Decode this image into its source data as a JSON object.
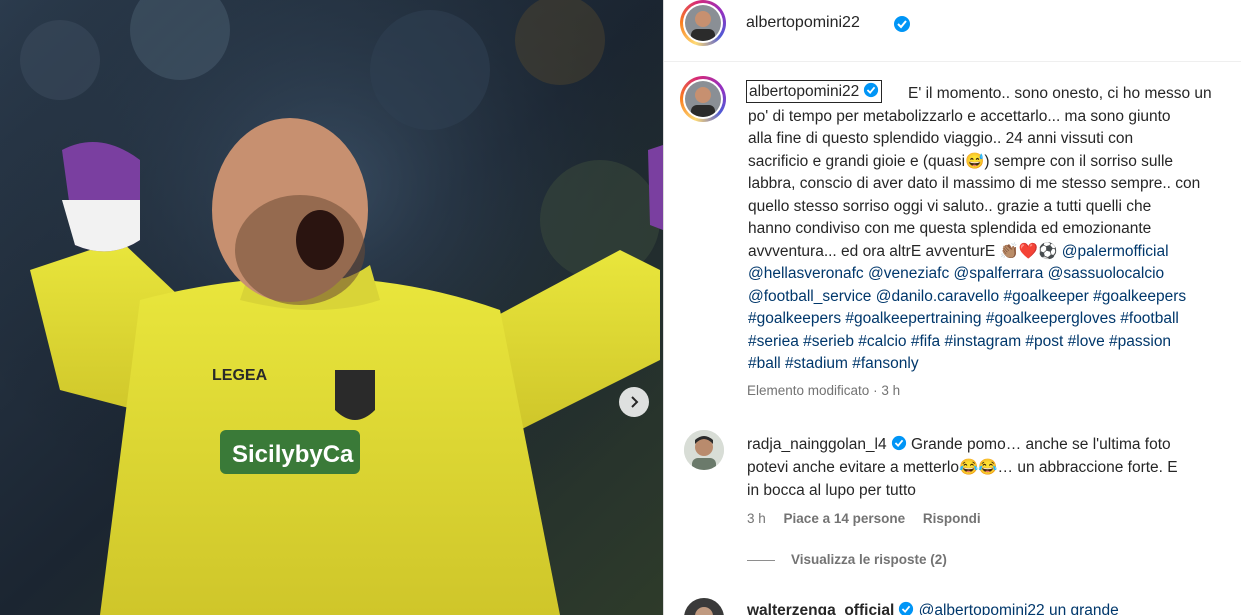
{
  "post": {
    "author": "albertopomini22",
    "verified": true
  },
  "caption": {
    "lines": [
      "E' il momento.. sono onesto, ci ho messo un",
      "po' di tempo per metabolizzarlo e accettarlo... ma sono giunto",
      "alla fine di questo splendido viaggio.. 24 anni vissuti con",
      "sacrificio e grandi gioie e (quasi😅) sempre con il sorriso sulle",
      "labbra, conscio di aver dato il massimo di me stesso sempre.. con",
      "quello stesso sorriso oggi vi saluto.. grazie a tutti quelli che",
      "hanno condiviso con me questa splendida ed emozionante",
      "avvventura... ed ora altrE avventurE 👏🏽❤️⚽"
    ],
    "mentions": [
      "@palermofficial",
      "@hellasveronafc",
      "@veneziafc",
      "@spalferrara",
      "@sassuolocalcio",
      "@football_service",
      "@danilo.caravello"
    ],
    "hashtag_lines": [
      "@hellasveronafc @veneziafc @spalferrara @sassuolocalcio",
      "@football_service @danilo.caravello #goalkeeper #goalkeepers",
      "#goalkeepers #goalkeepertraining #goalkeepergloves #football",
      "#seriea #serieb #calcio #fifa #instagram #post #love #passion",
      "#ball #stadium #fansonly"
    ],
    "edited_label": "Elemento modificato",
    "time": "3 h"
  },
  "comments": [
    {
      "user": "radja_nainggolan_l4",
      "verified": true,
      "lines": [
        "Grande pomo… anche se l'ultima foto",
        "potevi anche evitare a metterlo😂😂… un abbraccione forte. E",
        "in bocca al lupo per tutto"
      ],
      "time": "3 h",
      "likes": "Piace a 14 persone",
      "reply": "Rispondi",
      "view_replies": "Visualizza le risposte (2)"
    },
    {
      "user": "walterzenga_official",
      "verified": true,
      "preview": "@albertopomini22 un grande"
    }
  ],
  "photo": {
    "sponsor": "SicilybyCa",
    "kit_brand": "LEGEA"
  },
  "colors": {
    "verified": "#0095f6",
    "tag": "#00376b",
    "jersey": "#e6e33a"
  }
}
